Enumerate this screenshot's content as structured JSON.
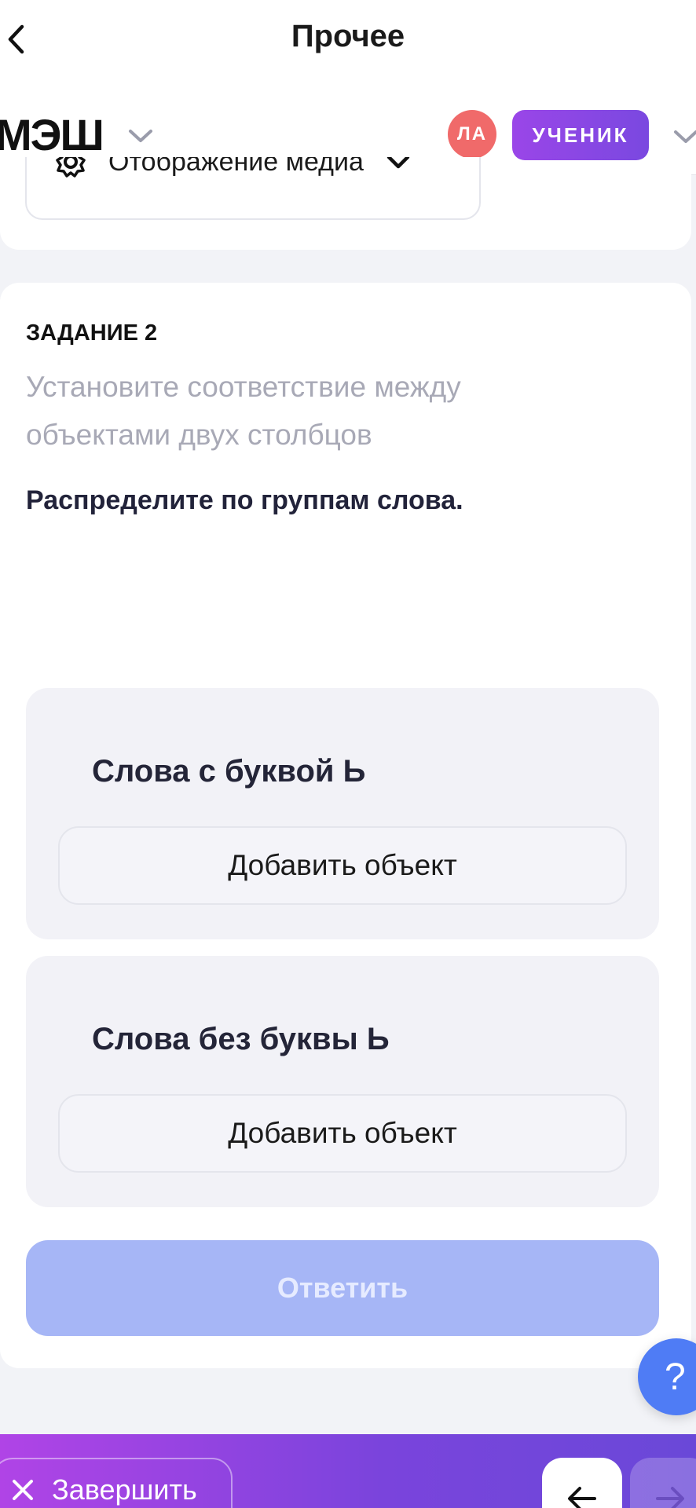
{
  "topbar": {
    "title": "Прочее",
    "back_icon": "chevron-left-icon"
  },
  "header": {
    "logo": "МЭШ",
    "avatar_initials": "ЛА",
    "role": "УЧЕНИК",
    "colors": {
      "avatar": "#f06a6a",
      "role_badge": "#8a46e4"
    }
  },
  "media": {
    "label": "Отображение медиа",
    "icon": "gear-icon",
    "chevron": "chevron-down-icon"
  },
  "task": {
    "heading": "ЗАДАНИЕ 2",
    "type": "Установите соответствие между объектами двух столбцов",
    "instruction": "Распределите по группам слова."
  },
  "groups": [
    {
      "title": "Слова с буквой Ь",
      "add_label": "Добавить объект"
    },
    {
      "title": "Слова без буквы Ь",
      "add_label": "Добавить объект"
    }
  ],
  "submit": {
    "label": "Ответить",
    "color": "#a6b6f6"
  },
  "help": {
    "label": "?"
  },
  "bottombar": {
    "finish_label": "Завершить",
    "prev_icon": "arrow-left-icon",
    "next_icon": "arrow-right-icon"
  }
}
